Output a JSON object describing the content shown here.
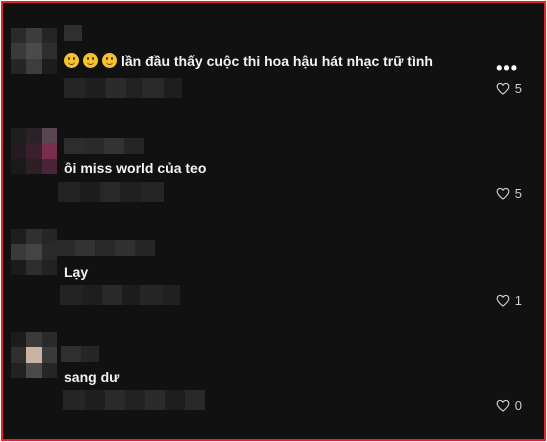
{
  "comments": [
    {
      "text": "lần đầu thấy cuộc thi hoa hậu hát nhạc trữ tình",
      "emoji_prefix": [
        "slightly-smiling-face",
        "slightly-smiling-face",
        "slightly-smiling-face"
      ],
      "likes": "5",
      "has_more_menu": true
    },
    {
      "text": "ôi miss world của teo",
      "likes": "5"
    },
    {
      "text": "Lạy",
      "likes": "1"
    },
    {
      "text": "sang dư",
      "likes": "0"
    }
  ],
  "more_menu_label": "•••",
  "icons": {
    "like": "heart-outline-icon",
    "more": "more-dots-icon"
  },
  "colors": {
    "background": "#111111",
    "frame_border": "#e0242a",
    "text": "#f2f2f2",
    "muted": "#cfcfcf"
  }
}
